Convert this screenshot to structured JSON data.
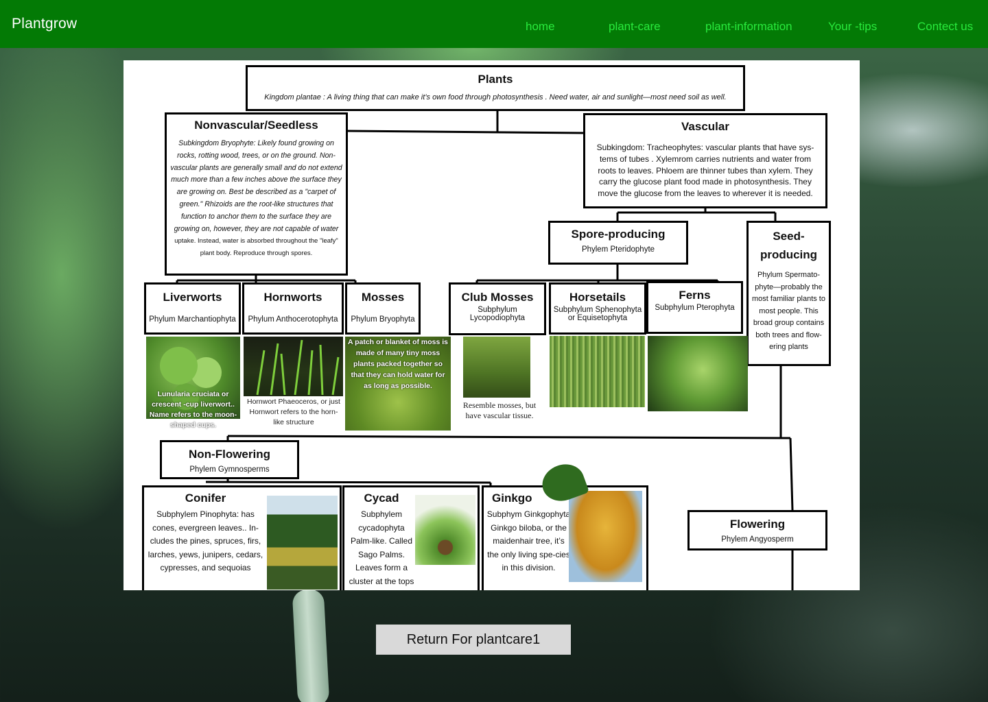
{
  "navbar": {
    "brand": "Plantgrow",
    "links": [
      "home",
      "plant-care",
      "plant-information",
      "Your -tips",
      "Contect us"
    ],
    "bg_color": "#037a05",
    "link_color": "#29ea3d"
  },
  "chart": {
    "root": {
      "title": "Plants",
      "desc": "Kingdom plantae :  A living thing that can make it’s own food through photosynthesis .  Need water, air and sunlight—most need soil as well."
    },
    "nonvascular": {
      "title": "Nonvascular/Seedless",
      "desc_italic": "Subkingdom Bryophyte: Likely found growing on rocks, rotting wood, trees, or on the ground. Non-vascular plants are generally small and do not extend much more than a few inches above the surface they are growing on. Best be described as a \"carpet of green.\" Rhizoids are the root-like structures that function to anchor them to the surface they are growing on, however, they are not capable of water",
      "desc_plain": " uptake. Instead, water is absorbed throughout the \"leafy\" plant body. Reproduce through spores."
    },
    "vascular": {
      "title": "Vascular",
      "desc": "Subkingdom: Tracheophytes: vascular plants that have sys-tems of tubes . Xylemrom carries nutrients and water from roots to leaves.  Phloem are thinner tubes than xylem. They carry the glucose plant food made in photosynthesis. They move the glucose from the leaves to wherever it is needed."
    },
    "spore": {
      "title": "Spore-producing",
      "sub": "Phylem Pteridophyte"
    },
    "seed": {
      "title": "Seed-producing",
      "desc": "Phylum Spermato-phyte—probably the most familiar plants to most people. This broad group contains both trees and flow-ering plants"
    },
    "liverworts": {
      "title": "Liverworts",
      "sub": "Phylum Marchantiophyta",
      "caption": "Lunularia cruciata or crescent -cup liverwort.. Name refers to the moon-shaped cups."
    },
    "hornworts": {
      "title": "Hornworts",
      "sub": "Phylum Anthocerotophyta",
      "caption": "Hornwort Phaeoceros, or just Hornwort refers to the horn-like structure"
    },
    "mosses": {
      "title": "Mosses",
      "sub": "Phylum Bryophyta",
      "caption": "A patch or blanket of moss is made of many tiny moss plants packed together so that they can hold water for as long as possible."
    },
    "clubmosses": {
      "title": "Club Mosses",
      "sub": "Subphylum Lycopodiophyta",
      "caption": "Resemble mosses, but have vascular tissue."
    },
    "horsetails": {
      "title": "Horsetails",
      "sub": "Subphylum Sphenophyta or Equisetophyta"
    },
    "ferns": {
      "title": "Ferns",
      "sub": "Subphylum Pterophyta"
    },
    "nonflowering": {
      "title": "Non-Flowering",
      "sub": "Phylem Gymnosperms"
    },
    "conifer": {
      "title": "Conifer",
      "desc": "Subphylem Pinophyta: has cones, evergreen leaves.. In-cludes the pines, spruces, firs, larches, yews, junipers, cedars, cypresses, and sequoias"
    },
    "cycad": {
      "title": "Cycad",
      "desc": "Subphylem cycadophyta Palm-like. Called Sago Palms. Leaves form a cluster at the tops of the trunks"
    },
    "ginkgo": {
      "title": "Ginkgo",
      "desc": "Subphym Ginkgophyta Ginkgo biloba, or the maidenhair tree, it’s the only living spe-cies in this division."
    },
    "flowering": {
      "title": "Flowering",
      "sub": "Phylem Angyosperm"
    }
  },
  "return_button": {
    "label": "Return For plantcare1"
  }
}
